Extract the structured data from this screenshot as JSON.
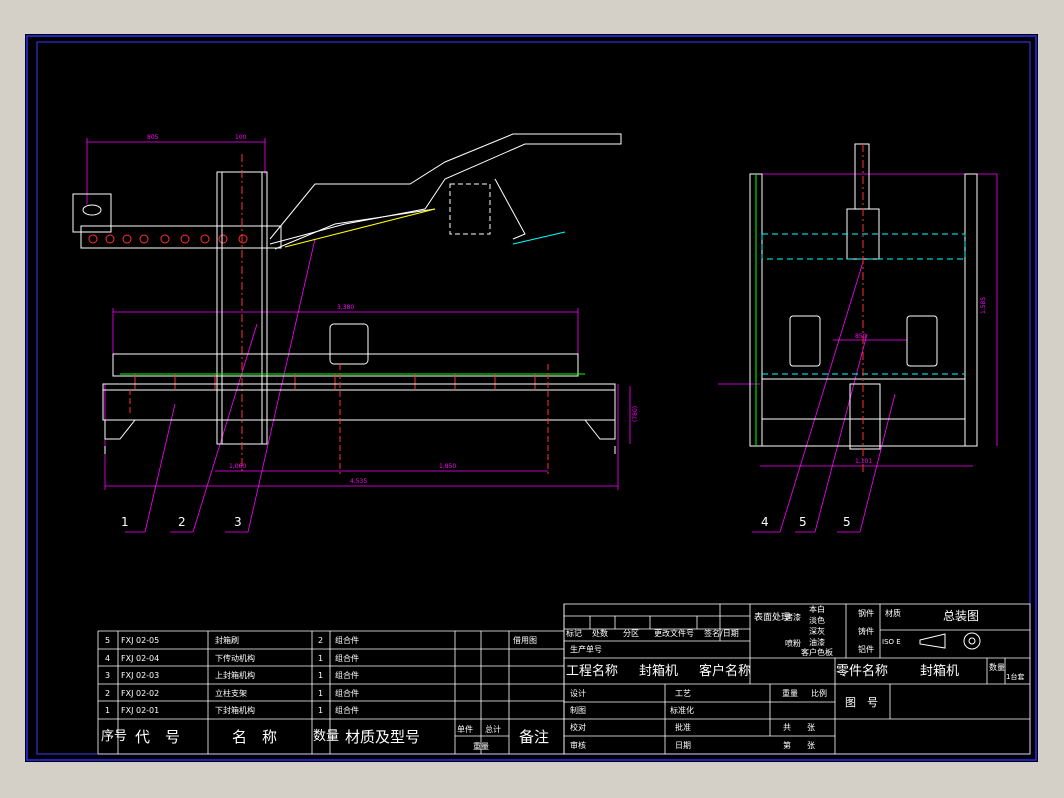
{
  "bom": {
    "rows": [
      {
        "no": "5",
        "code": "FXJ 02-05",
        "name": "封箱刷",
        "qty": "2",
        "material": "组合件",
        "remark": "借用图"
      },
      {
        "no": "4",
        "code": "FXJ 02-04",
        "name": "下传动机构",
        "qty": "1",
        "material": "组合件",
        "remark": ""
      },
      {
        "no": "3",
        "code": "FXJ 02-03",
        "name": "上封箱机构",
        "qty": "1",
        "material": "组合件",
        "remark": ""
      },
      {
        "no": "2",
        "code": "FXJ 02-02",
        "name": "立柱支架",
        "qty": "1",
        "material": "组合件",
        "remark": ""
      },
      {
        "no": "1",
        "code": "FXJ 02-01",
        "name": "下封箱机构",
        "qty": "1",
        "material": "组合件",
        "remark": ""
      }
    ],
    "header": {
      "no": "序号",
      "code": "代　号",
      "name": "名　称",
      "qty": "数量",
      "material": "材质及型号",
      "single": "单件",
      "total": "总计",
      "weight": "重量",
      "remark": "备注"
    }
  },
  "title_block": {
    "revision_labels": [
      "标记",
      "处数",
      "分区",
      "更改文件号",
      "签名/日期"
    ],
    "production_no": "生产单号",
    "surface": "表面处理",
    "finish_a": [
      "烤漆",
      "喷粉"
    ],
    "finish_b": [
      "本白",
      "淡色",
      "深灰",
      "油漆",
      "客户色板"
    ],
    "material_opts": [
      "钢件",
      "铸件",
      "铝件"
    ],
    "material_label": "材质",
    "iso": "ISO E",
    "drawing_title": "总装图",
    "project_label": "工程名称",
    "project_value": "封箱机",
    "customer_label": "客户名称",
    "part_name_label": "零件名称",
    "part_name_value": "封箱机",
    "qty_label": "数量",
    "qty_value": "1台套",
    "design": "设计",
    "craft": "工艺",
    "draw": "制图",
    "standard": "标准化",
    "check": "校对",
    "approve": "批准",
    "review": "审核",
    "date": "日期",
    "weight": "重量",
    "scale": "比例",
    "drawing_no": "图　号",
    "total_sheets": "共　　张",
    "sheet_no": "第　　张"
  },
  "callouts": [
    "1",
    "2",
    "3",
    "4",
    "5",
    "5"
  ],
  "dims": {
    "d1": "805",
    "d2": "100",
    "d3": "3,380",
    "d4": "1,060",
    "d5": "1,850",
    "d6": "4,535",
    "d7": "1,101",
    "d8": "850",
    "d9": "1,585",
    "d10": "(780)"
  },
  "colors": {
    "bg": "#000000",
    "frame": "#2b2bff",
    "line": "#ffffff",
    "dim": "#ff00ff",
    "center": "#ff3030",
    "hidden": "#00ffff",
    "green": "#00ff00",
    "yellow": "#ffff00"
  }
}
